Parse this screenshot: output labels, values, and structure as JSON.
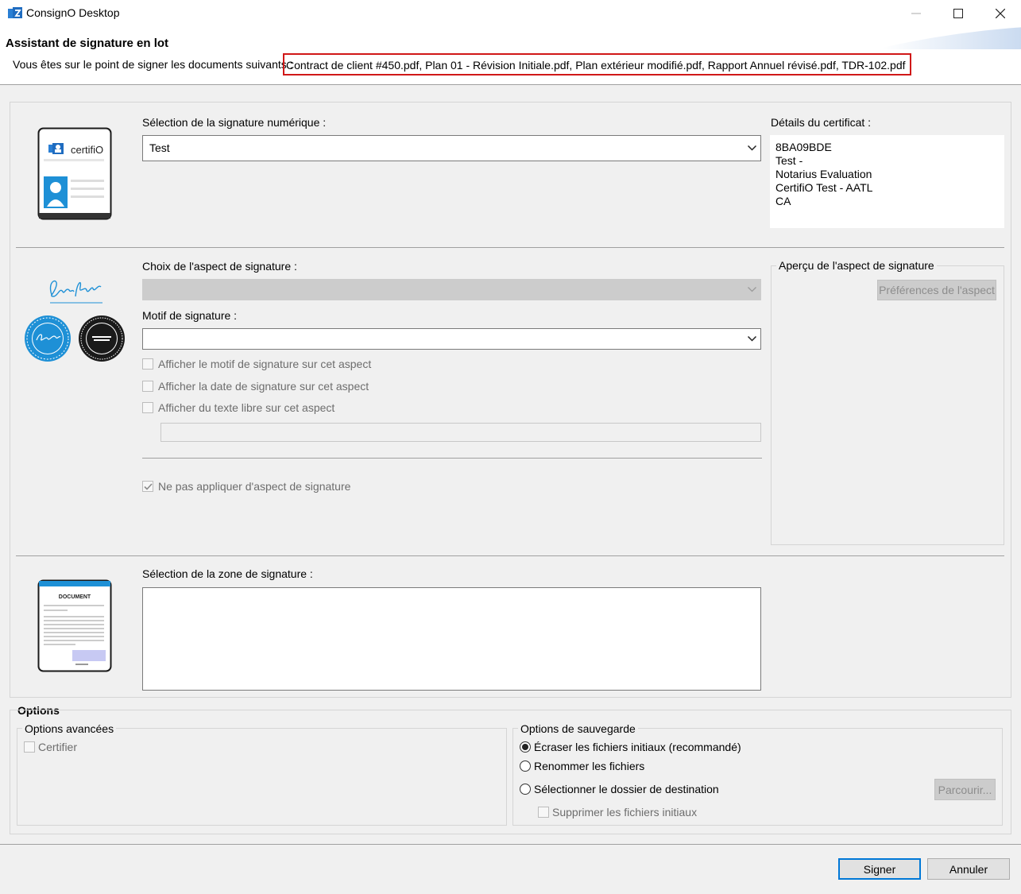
{
  "window": {
    "title": "ConsignO Desktop",
    "icon": "consigno-app-icon",
    "controls": [
      "minimize-icon",
      "maximize-icon",
      "close-icon"
    ]
  },
  "header": {
    "title": "Assistant de signature en lot",
    "intro": "Vous êtes sur le point de signer les documents suivants :",
    "documents": "Contract de client  #450.pdf, Plan 01 - Révision Initiale.pdf, Plan extérieur modifié.pdf, Rapport Annuel révisé.pdf, TDR-102.pdf",
    "highlight_color": "#d01818"
  },
  "digital_signature": {
    "label": "Sélection de la signature numérique :",
    "selected": "Test",
    "card_brand": "certifiO",
    "details_label": "Détails du certificat :",
    "details": [
      "8BA09BDE",
      "Test -",
      "Notarius Evaluation",
      "CertifiO Test - AATL",
      "CA"
    ]
  },
  "appearance": {
    "label": "Choix de l'aspect de signature :",
    "selected": "",
    "reason_label": "Motif de signature :",
    "reason_value": "",
    "checkboxes": [
      {
        "label": "Afficher le motif de signature sur cet aspect",
        "checked": false
      },
      {
        "label": "Afficher la date de signature sur cet aspect",
        "checked": false
      },
      {
        "label": "Afficher du texte libre sur cet aspect",
        "checked": false
      }
    ],
    "free_text_value": "",
    "no_appearance_label": "Ne pas appliquer d'aspect de signature",
    "preview_title": "Aperçu de l'aspect de signature",
    "preferences_button": "Préférences de l'aspect"
  },
  "zone": {
    "label": "Sélection de la zone de signature :",
    "doc_icon_title": "DOCUMENT"
  },
  "options": {
    "title": "Options",
    "advanced_title": "Options avancées",
    "certify_label": "Certifier",
    "save_title": "Options de sauvegarde",
    "save_choices": [
      {
        "label": "Écraser les fichiers initiaux (recommandé)",
        "checked": true
      },
      {
        "label": "Renommer les fichiers",
        "checked": false
      },
      {
        "label": "Sélectionner le dossier de destination",
        "checked": false
      }
    ],
    "browse_button": "Parcourir...",
    "delete_originals_label": "Supprimer les fichiers initiaux"
  },
  "footer": {
    "sign_button": "Signer",
    "cancel_button": "Annuler"
  },
  "colors": {
    "accent": "#0078d7",
    "seal_blue": "#1e90d6",
    "seal_black": "#1a1a1a"
  }
}
